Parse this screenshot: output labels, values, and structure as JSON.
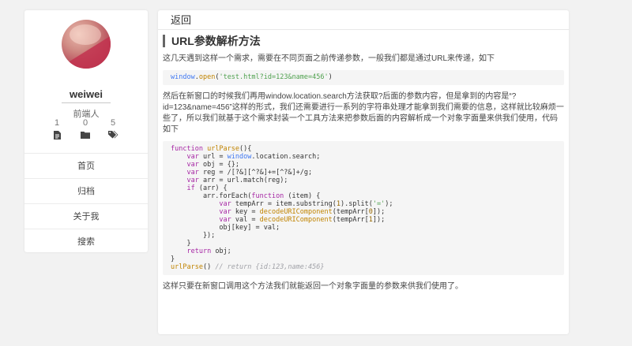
{
  "sidebar": {
    "username": "weiwei",
    "role": "前端人",
    "stats": [
      {
        "count": "1",
        "icon": "document-icon"
      },
      {
        "count": "0",
        "icon": "folder-icon"
      },
      {
        "count": "5",
        "icon": "tags-icon"
      }
    ],
    "menu": [
      "首页",
      "归档",
      "关于我",
      "搜索"
    ]
  },
  "main": {
    "back_label": "返回",
    "title": "URL参数解析方法",
    "intro": "这几天遇到这样一个需求，需要在不同页面之前传递参数，一般我们都是通过URL来传递，如下",
    "inline_code": "window.open('test.html?id=123&name=456')",
    "explanation": "然后在新窗口的时候我们再用window.location.search方法获取?后面的参数内容，但是拿到的内容是“?id=123&name=456”这样的形式，我们还需要进行一系列的字符串处理才能拿到我们需要的信息，这样就比较麻烦一些了，所以我们就基于这个需求封装一个工具方法来把参数后面的内容解析成一个对象字面量来供我们使用，代码如下",
    "code_lines": [
      "function urlParse(){",
      "    var url = window.location.search;",
      "    var obj = {};",
      "    var reg = /[?&][^?&]+=[^?&]+/g;",
      "    var arr = url.match(reg);",
      "    if (arr) {",
      "        arr.forEach(function (item) {",
      "            var tempArr = item.substring(1).split('=');",
      "            var key = decodeURIComponent(tempArr[0]);",
      "            var val = decodeURIComponent(tempArr[1]);",
      "            obj[key] = val;",
      "        });",
      "    }",
      "    return obj;",
      "}",
      "urlParse() // return {id:123,name:456}"
    ],
    "conclusion": "这样只要在新窗口调用这个方法我们就能返回一个对象字面量的参数来供我们使用了。"
  },
  "colors": {
    "background": "#f2f2f2",
    "card": "#ffffff",
    "code_background": "#f5f5f5",
    "keyword": "#a626a4",
    "function": "#c18401",
    "string": "#50a14f",
    "comment": "#a0a1a7"
  }
}
